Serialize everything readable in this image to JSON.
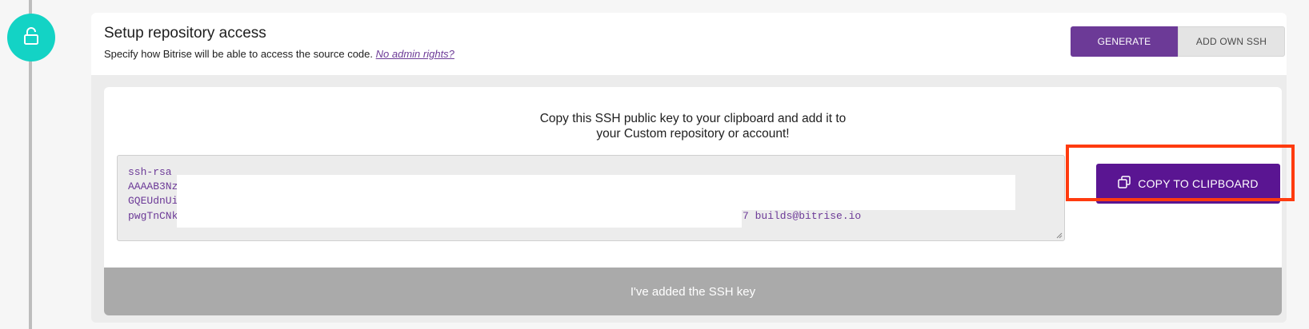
{
  "section": {
    "title": "Setup repository access",
    "subtitle": "Specify how Bitrise will be able to access the source code.",
    "no_admin_link": "No admin rights?"
  },
  "mode_toggle": {
    "generate_label": "GENERATE",
    "own_ssh_label": "ADD OWN SSH"
  },
  "ssh": {
    "instruction_line1": "Copy this SSH public key to your clipboard and add it to",
    "instruction_line2": "your Custom repository or account!",
    "key_lines": [
      "ssh-rsa",
      "AAAAB3Nz",
      "GQEUdnUi",
      "pwgTnCNk"
    ],
    "key_suffix": "7 builds@bitrise.io",
    "copy_label": "COPY TO CLIPBOARD",
    "confirm_label": "I've added the SSH key"
  },
  "icons": {
    "step": "lock-open-icon",
    "copy": "copy-icon"
  },
  "colors": {
    "brand_purple": "#6c3a97",
    "button_purple": "#5a1592",
    "step_teal": "#13d3c5",
    "highlight_red": "#ff3b0f",
    "disabled_gray": "#aaaaaa"
  }
}
